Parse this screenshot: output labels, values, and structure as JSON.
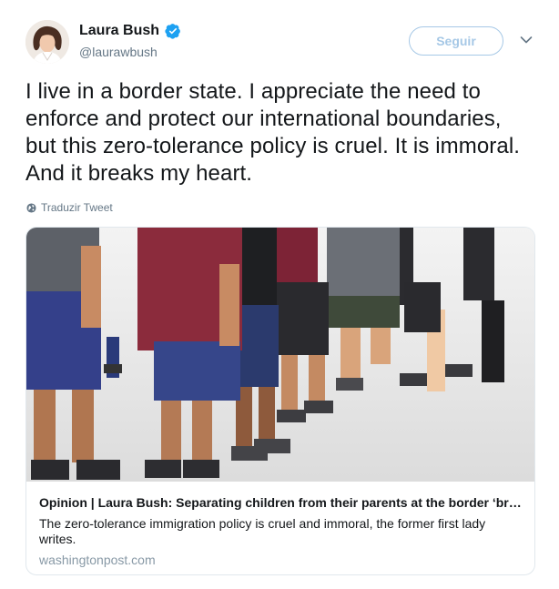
{
  "author": {
    "name": "Laura Bush",
    "handle": "@laurawbush",
    "verified_icon": "verified-badge-icon",
    "avatar_icon": "profile-photo"
  },
  "actions": {
    "follow_label": "Seguir",
    "caret_icon": "chevron-down-icon"
  },
  "tweet": {
    "text": "I live in a border state. I appreciate the need to enforce and protect our international boundaries, but this zero-tolerance policy is cruel. It is immoral. And it breaks my heart.",
    "translate_label": "Traduzir Tweet",
    "translate_icon": "globe-icon"
  },
  "card": {
    "title": "Opinion | Laura Bush: Separating children from their parents at the border ‘breaks my heart’",
    "description": "The zero-tolerance immigration policy is cruel and immoral, the former first lady writes.",
    "domain": "washingtonpost.com",
    "image_icon": "photo-children-in-line"
  },
  "colors": {
    "verified": "#1da1f2",
    "follow_border": "#a6c8e6",
    "muted_text": "#657786",
    "domain_text": "#8899a6"
  }
}
